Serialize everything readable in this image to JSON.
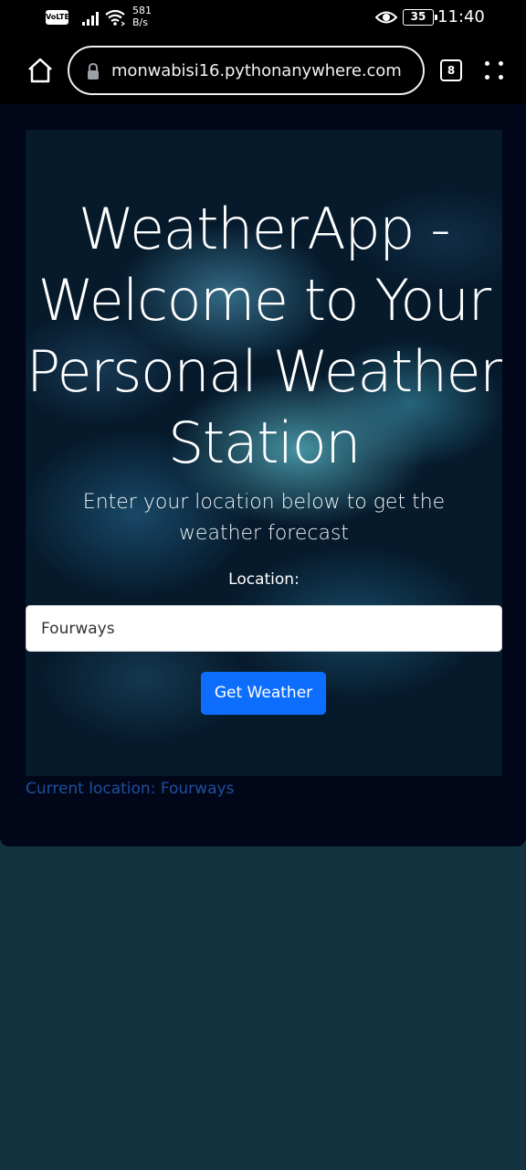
{
  "status_bar": {
    "volte": "VoLTE",
    "net_speed_value": "581",
    "net_speed_unit": "B/s",
    "battery": "35",
    "time": "11:40"
  },
  "browser": {
    "url": "monwabisi16.pythonanywhere.com",
    "tab_count": "8"
  },
  "page": {
    "title": "WeatherApp - Welcome to Your Personal Weather Station",
    "subtitle": "Enter your location below to get the weather forecast",
    "location_label": "Location:",
    "location_value": "Fourways",
    "submit_label": "Get Weather",
    "current_location": "Current location: Fourways"
  },
  "colors": {
    "primary_button": "#0d6efd",
    "page_background": "#12333f",
    "card_background": "#010718",
    "current_location_text": "#1f4f9e"
  }
}
